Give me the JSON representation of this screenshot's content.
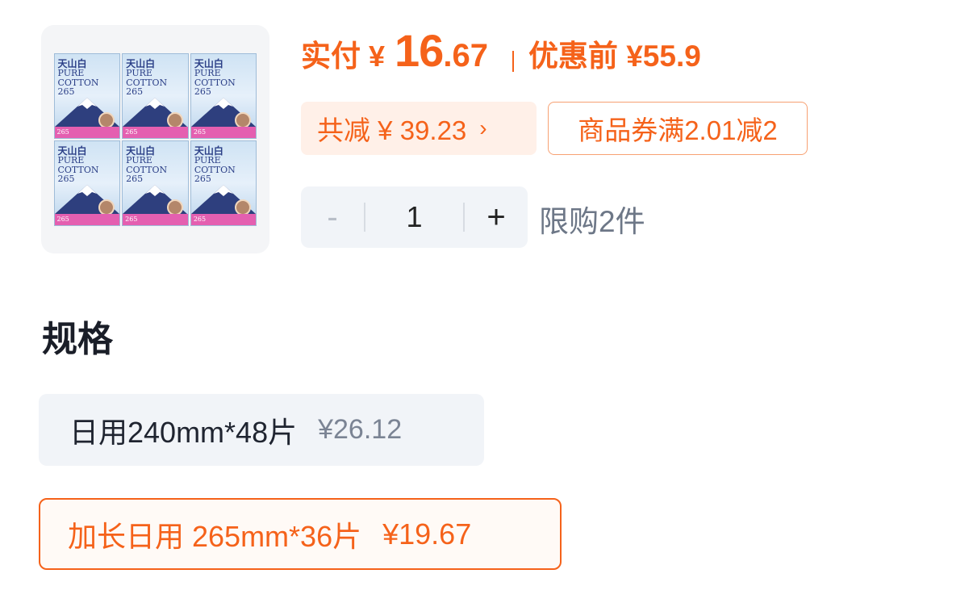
{
  "product": {
    "image_alt": "天山白 PURE COTTON 265 sanitary pad packs",
    "pack_brand": "天山白",
    "pack_line1": "PURE",
    "pack_line2": "COTTON",
    "pack_size": "265"
  },
  "price": {
    "pay_label": "实付",
    "currency": "¥",
    "amount_int": "16",
    "amount_dec": ".67",
    "original": "优惠前 ¥55.9"
  },
  "discounts": {
    "total": "共减 ¥ 39.23",
    "total_chevron": "›",
    "coupon": "商品券满2.01减2"
  },
  "quantity": {
    "minus": "-",
    "value": "1",
    "plus": "+",
    "limit": "限购2件"
  },
  "spec": {
    "title": "规格",
    "options": [
      {
        "label": "日用240mm*48片",
        "price": "¥26.12",
        "selected": false
      },
      {
        "label": "加长日用 265mm*36片",
        "price": "¥19.67",
        "selected": true
      }
    ]
  },
  "colors": {
    "accent": "#f5621a",
    "tag_bg": "#fff0e8",
    "option_bg": "#f1f4f8"
  }
}
